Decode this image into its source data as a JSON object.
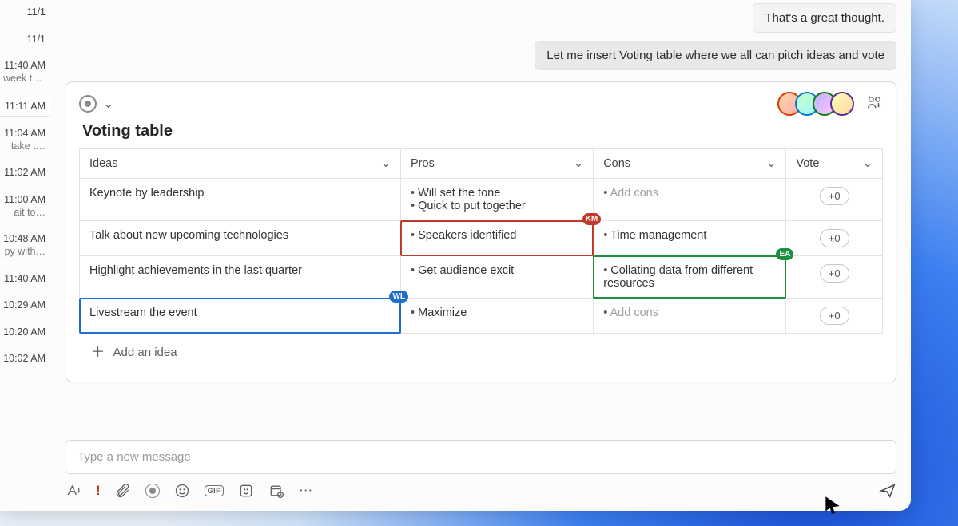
{
  "sidebar": {
    "items": [
      {
        "time": "11/1",
        "sub": ""
      },
      {
        "time": "11/1",
        "sub": ""
      },
      {
        "time": "11:40 AM",
        "sub": "week to…"
      },
      {
        "time": "11:11 AM",
        "sub": ""
      },
      {
        "time": "11:04 AM",
        "sub": "take t…"
      },
      {
        "time": "11:02 AM",
        "sub": ""
      },
      {
        "time": "11:00 AM",
        "sub": "ait to…"
      },
      {
        "time": "10:48 AM",
        "sub": "py with…"
      },
      {
        "time": "11:40 AM",
        "sub": ""
      },
      {
        "time": "10:29 AM",
        "sub": ""
      },
      {
        "time": "10:20 AM",
        "sub": ""
      },
      {
        "time": "10:02 AM",
        "sub": ""
      }
    ],
    "selected_index": 3
  },
  "messages": {
    "m1": "That's a great thought.",
    "m2": "Let me insert Voting table where we all can pitch ideas and vote"
  },
  "loop": {
    "title": "Voting table",
    "columns": {
      "ideas": "Ideas",
      "pros": "Pros",
      "cons": "Cons",
      "vote": "Vote"
    },
    "rows": [
      {
        "idea": "Keynote by leadership",
        "pros": [
          "Will set the tone",
          "Quick to put together"
        ],
        "cons_placeholder": "Add cons",
        "vote": "+0"
      },
      {
        "idea": "Talk about new upcoming technologies",
        "pros": [
          "Speakers identified"
        ],
        "cons": [
          "Time management"
        ],
        "vote": "+0",
        "pros_tag": "KM"
      },
      {
        "idea": "Highlight achievements in the last quarter",
        "pros": [
          "Get audience excit"
        ],
        "cons": [
          "Collating data from different resources"
        ],
        "vote": "+0",
        "cons_tag": "EA"
      },
      {
        "idea": "Livestream the event",
        "pros": [
          "Maximize"
        ],
        "cons_placeholder": "Add cons",
        "vote": "+0",
        "idea_tag": "WL"
      }
    ],
    "add_idea_label": "Add an idea"
  },
  "compose": {
    "placeholder": "Type a new message",
    "gif_label": "GIF"
  }
}
